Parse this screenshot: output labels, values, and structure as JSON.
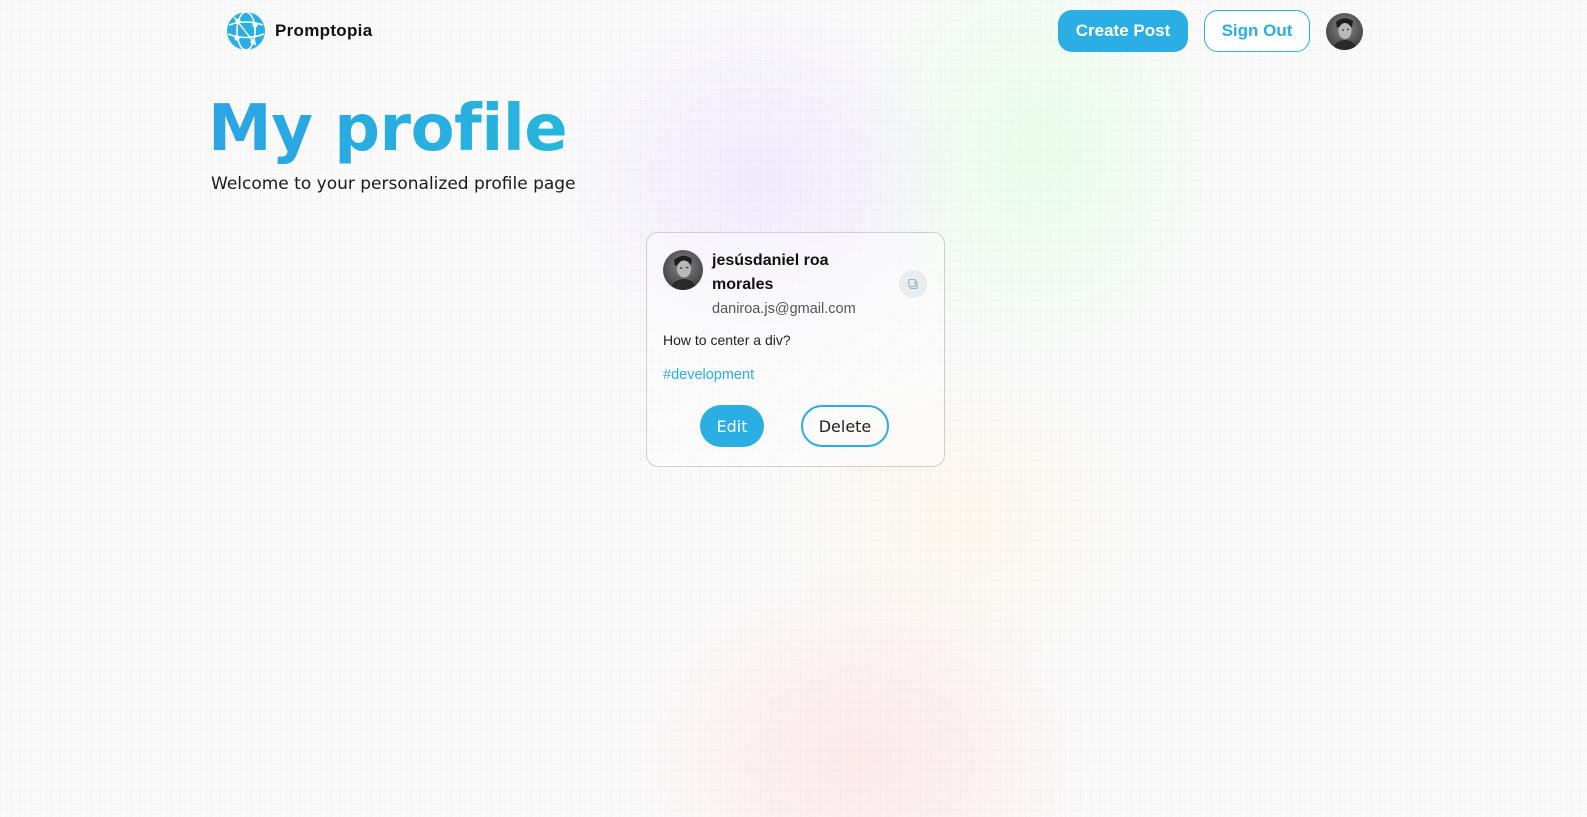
{
  "nav": {
    "brand_name": "Promptopia",
    "brand_icon": "globe-network-icon",
    "create_post_label": "Create Post",
    "sign_out_label": "Sign Out",
    "avatar_icon": "user-avatar"
  },
  "header": {
    "title": "My profile",
    "description": "Welcome to your personalized profile page"
  },
  "posts": [
    {
      "username": "jesúsdaniel roa morales",
      "email": "daniroa.js@gmail.com",
      "prompt": "How to center a div?",
      "tag": "#development",
      "copy_icon": "copy-icon",
      "edit_label": "Edit",
      "delete_label": "Delete"
    }
  ],
  "colors": {
    "accent": "#2aaee4",
    "text": "#111111",
    "muted": "#555555"
  }
}
